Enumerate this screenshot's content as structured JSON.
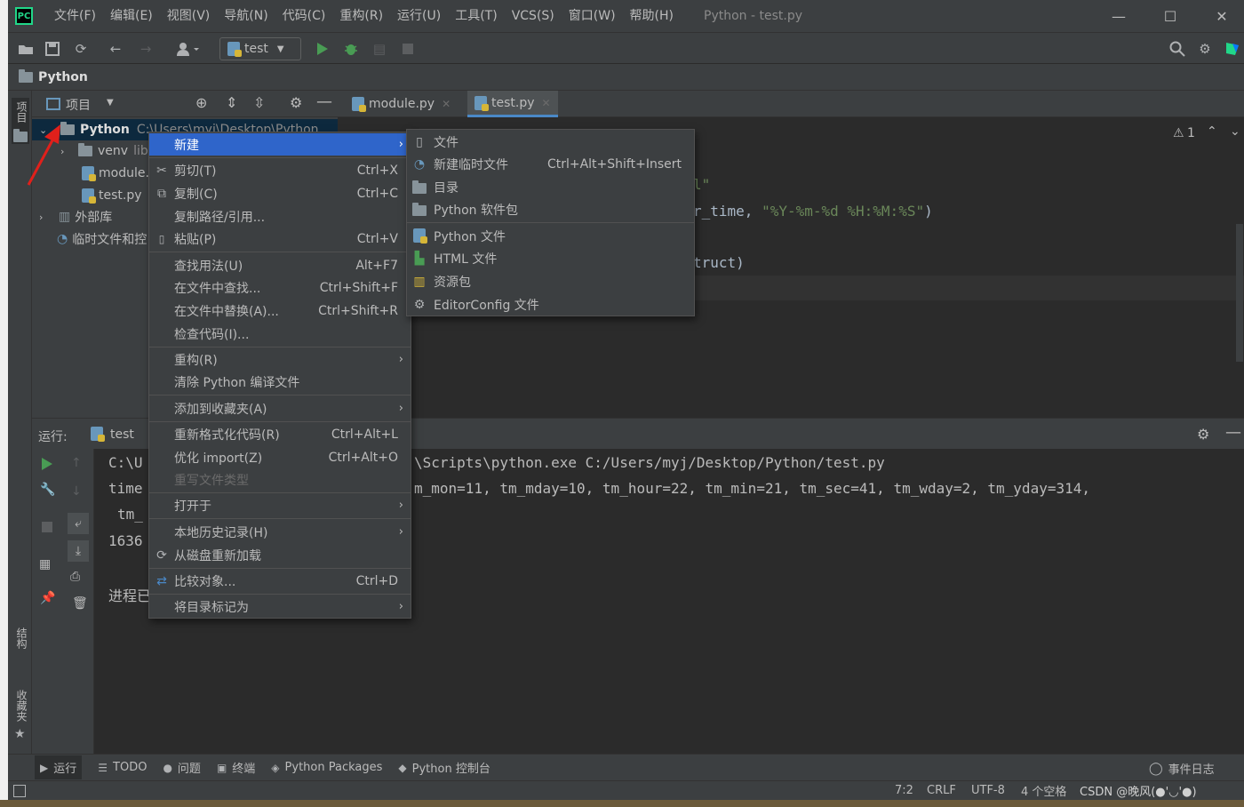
{
  "title_bar": {
    "logo": "PC",
    "menus": [
      "文件(F)",
      "编辑(E)",
      "视图(V)",
      "导航(N)",
      "代码(C)",
      "重构(R)",
      "运行(U)",
      "工具(T)",
      "VCS(S)",
      "窗口(W)",
      "帮助(H)"
    ],
    "window_title": "Python - test.py",
    "controls": {
      "minimize": "—",
      "maximize": "☐",
      "close": "✕"
    }
  },
  "toolbar": {
    "run_config": "test"
  },
  "navbar": {
    "project": "Python"
  },
  "left_stripe": {
    "project": "项目",
    "structure": "结构",
    "favorites": "收藏夹"
  },
  "project_panel": {
    "header_label": "项目",
    "tree": {
      "root": "Python",
      "root_path": "C:\\Users\\myj\\Desktop\\Python",
      "venv": "venv",
      "venv_suffix": "lib",
      "module": "module.",
      "test": "test.py",
      "ext_libs": "外部库",
      "scratch": "临时文件和控"
    }
  },
  "editor": {
    "tabs": [
      {
        "label": "module.py"
      },
      {
        "label": "test.py"
      }
    ],
    "warnings": "1",
    "code": {
      "line_a": "l\"",
      "line_b_code": "r_time, ",
      "line_b_str": "\"%Y-%m-%d %H:%M:%S\"",
      "line_b_end": ")",
      "line_c": "truct)"
    }
  },
  "run_panel": {
    "label": "运行:",
    "tab": "test",
    "output": {
      "l1": "C:\\U",
      "l1_rest": "\\Scripts\\python.exe C:/Users/myj/Desktop/Python/test.py",
      "l2": "time",
      "l2_rest": "m_mon=11, tm_mday=10, tm_hour=22, tm_min=21, tm_sec=41, tm_wday=2, tm_yday=314,",
      "l3": "tm_",
      "l4": "1636",
      "l5": "进程已"
    }
  },
  "context_menu": {
    "items": [
      {
        "label": "新建",
        "submenu": true,
        "highlight": true
      },
      {
        "label": "剪切(T)",
        "shortcut": "Ctrl+X",
        "icon": "✂"
      },
      {
        "label": "复制(C)",
        "shortcut": "Ctrl+C",
        "icon": "⧉"
      },
      {
        "label": "复制路径/引用..."
      },
      {
        "label": "粘贴(P)",
        "shortcut": "Ctrl+V",
        "icon": "📋"
      },
      {
        "label": "查找用法(U)",
        "shortcut": "Alt+F7"
      },
      {
        "label": "在文件中查找...",
        "shortcut": "Ctrl+Shift+F"
      },
      {
        "label": "在文件中替换(A)...",
        "shortcut": "Ctrl+Shift+R"
      },
      {
        "label": "检查代码(I)..."
      },
      {
        "label": "重构(R)",
        "submenu": true
      },
      {
        "label": "清除 Python 编译文件"
      },
      {
        "label": "添加到收藏夹(A)",
        "submenu": true
      },
      {
        "label": "重新格式化代码(R)",
        "shortcut": "Ctrl+Alt+L"
      },
      {
        "label": "优化 import(Z)",
        "shortcut": "Ctrl+Alt+O"
      },
      {
        "label": "重写文件类型",
        "disabled": true
      },
      {
        "label": "打开于",
        "submenu": true
      },
      {
        "label": "本地历史记录(H)",
        "submenu": true
      },
      {
        "label": "从磁盘重新加载",
        "icon": "⟳"
      },
      {
        "label": "比较对象...",
        "shortcut": "Ctrl+D",
        "icon": "⇄"
      },
      {
        "label": "将目录标记为",
        "submenu": true
      }
    ]
  },
  "submenu_new": {
    "items": [
      {
        "label": "文件"
      },
      {
        "label": "新建临时文件",
        "shortcut": "Ctrl+Alt+Shift+Insert"
      },
      {
        "label": "目录"
      },
      {
        "label": "Python 软件包"
      },
      {
        "label": "Python 文件"
      },
      {
        "label": "HTML 文件"
      },
      {
        "label": "资源包"
      },
      {
        "label": "EditorConfig 文件"
      }
    ]
  },
  "bottom_tools": [
    {
      "label": "运行",
      "icon": "▶"
    },
    {
      "label": "TODO",
      "icon": "☰"
    },
    {
      "label": "问题",
      "icon": "●"
    },
    {
      "label": "终端",
      "icon": "▣"
    },
    {
      "label": "Python Packages",
      "icon": "◈"
    },
    {
      "label": "Python 控制台",
      "icon": "◆"
    }
  ],
  "event_log": "事件日志",
  "status_bar": {
    "position": "7:2",
    "line_sep": "CRLF",
    "encoding": "UTF-8",
    "indent": "4 个空格",
    "watermark": "CSDN @晚风(●'◡'●)"
  },
  "colors": {
    "accent": "#2f65ca",
    "run_green": "#499c54",
    "string_green": "#6a8759",
    "annotation_red": "#e0201b"
  }
}
